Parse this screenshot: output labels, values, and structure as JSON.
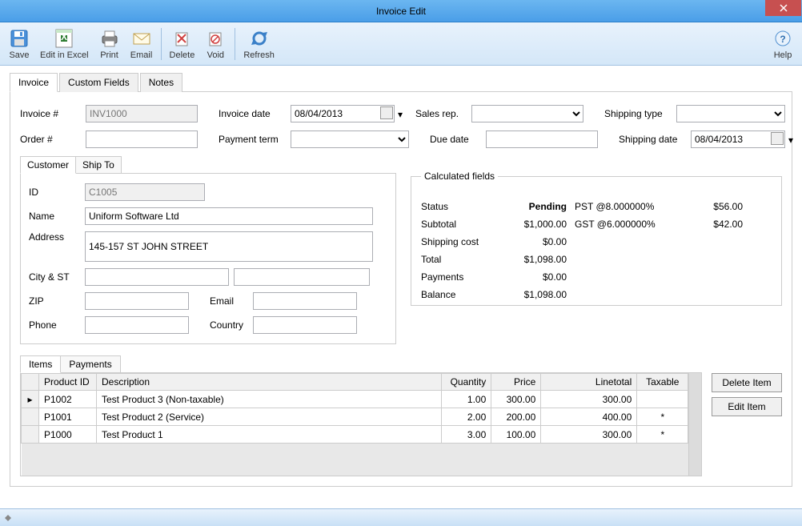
{
  "window": {
    "title": "Invoice Edit"
  },
  "toolbar": {
    "save": "Save",
    "edit_excel": "Edit in Excel",
    "print": "Print",
    "email": "Email",
    "delete": "Delete",
    "void": "Void",
    "refresh": "Refresh",
    "help": "Help"
  },
  "tabs": {
    "invoice": "Invoice",
    "custom": "Custom Fields",
    "notes": "Notes"
  },
  "invoice": {
    "labels": {
      "number": "Invoice #",
      "order": "Order #",
      "inv_date": "Invoice date",
      "pay_term": "Payment term",
      "sales_rep": "Sales rep.",
      "due_date": "Due date",
      "ship_type": "Shipping type",
      "ship_date": "Shipping date"
    },
    "values": {
      "number": "INV1000",
      "order": "",
      "inv_date": "08/04/2013",
      "pay_term": "",
      "sales_rep": "",
      "due_date": "",
      "ship_type": "",
      "ship_date": "08/04/2013"
    }
  },
  "customer_tabs": {
    "customer": "Customer",
    "ship_to": "Ship To"
  },
  "customer": {
    "labels": {
      "id": "ID",
      "name": "Name",
      "address": "Address",
      "city_st": "City & ST",
      "zip": "ZIP",
      "email": "Email",
      "phone": "Phone",
      "country": "Country"
    },
    "values": {
      "id": "C1005",
      "name": "Uniform Software Ltd",
      "address": "145-157 ST JOHN STREET",
      "city": "",
      "state": "",
      "zip": "",
      "email": "",
      "phone": "",
      "country": ""
    }
  },
  "calc": {
    "legend": "Calculated fields",
    "labels": {
      "status": "Status",
      "subtotal": "Subtotal",
      "shipping": "Shipping cost",
      "total": "Total",
      "payments": "Payments",
      "balance": "Balance",
      "pst": "PST @8.000000%",
      "gst": "GST @6.000000%"
    },
    "values": {
      "status": "Pending",
      "subtotal": "$1,000.00",
      "shipping": "$0.00",
      "total": "$1,098.00",
      "payments": "$0.00",
      "balance": "$1,098.00",
      "pst": "$56.00",
      "gst": "$42.00"
    }
  },
  "items_tabs": {
    "items": "Items",
    "payments": "Payments"
  },
  "items": {
    "headers": {
      "pid": "Product ID",
      "desc": "Description",
      "qty": "Quantity",
      "price": "Price",
      "linetotal": "Linetotal",
      "taxable": "Taxable"
    },
    "rows": [
      {
        "pid": "P1002",
        "desc": "Test Product 3 (Non-taxable)",
        "qty": "1.00",
        "price": "300.00",
        "linetotal": "300.00",
        "taxable": ""
      },
      {
        "pid": "P1001",
        "desc": "Test Product 2 (Service)",
        "qty": "2.00",
        "price": "200.00",
        "linetotal": "400.00",
        "taxable": "*"
      },
      {
        "pid": "P1000",
        "desc": "Test Product 1",
        "qty": "3.00",
        "price": "100.00",
        "linetotal": "300.00",
        "taxable": "*"
      }
    ]
  },
  "item_buttons": {
    "delete": "Delete Item",
    "edit": "Edit Item"
  }
}
